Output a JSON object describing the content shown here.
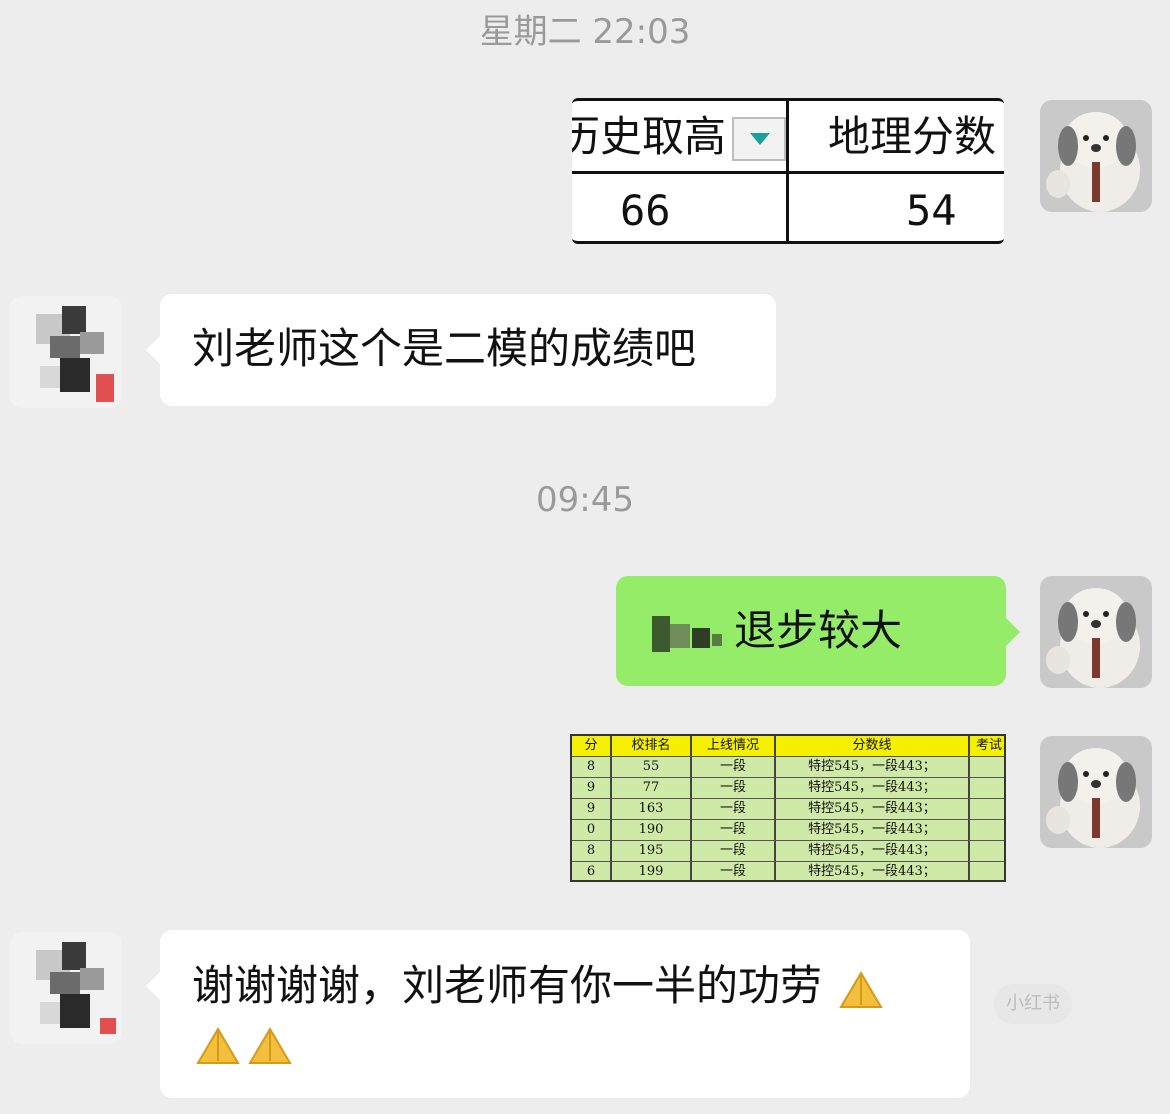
{
  "chat": {
    "timestamp_1": "星期二 22:03",
    "timestamp_2": "09:45",
    "msg_sent_image_1": {
      "col1_header": "历史取高",
      "col2_header": "地理分数",
      "col1_value": "66",
      "col2_value": "54"
    },
    "msg_received_1": "刘老师这个是二模的成绩吧",
    "msg_sent_2": "退步较大",
    "msg_sent_image_2": {
      "headers": [
        "分",
        "校排名",
        "上线情况",
        "分数线",
        "考试"
      ],
      "rows": [
        [
          "8",
          "55",
          "一段",
          "特控545，一段443；"
        ],
        [
          "9",
          "77",
          "一段",
          "特控545，一段443；"
        ],
        [
          "9",
          "163",
          "一段",
          "特控545，一段443；"
        ],
        [
          "0",
          "190",
          "一段",
          "特控545，一段443；"
        ],
        [
          "8",
          "195",
          "一段",
          "特控545，一段443；"
        ],
        [
          "6",
          "199",
          "一段",
          "特控545，一段443；"
        ]
      ]
    },
    "msg_received_2": "谢谢谢谢，刘老师有你一半的功劳",
    "emoji_name": "folded-hands-emoji",
    "watermark": "小红书"
  },
  "colors": {
    "background": "#ededed",
    "sent_bubble": "#95ec69",
    "received_bubble": "#ffffff",
    "timestamp_text": "#9a9a9a"
  }
}
